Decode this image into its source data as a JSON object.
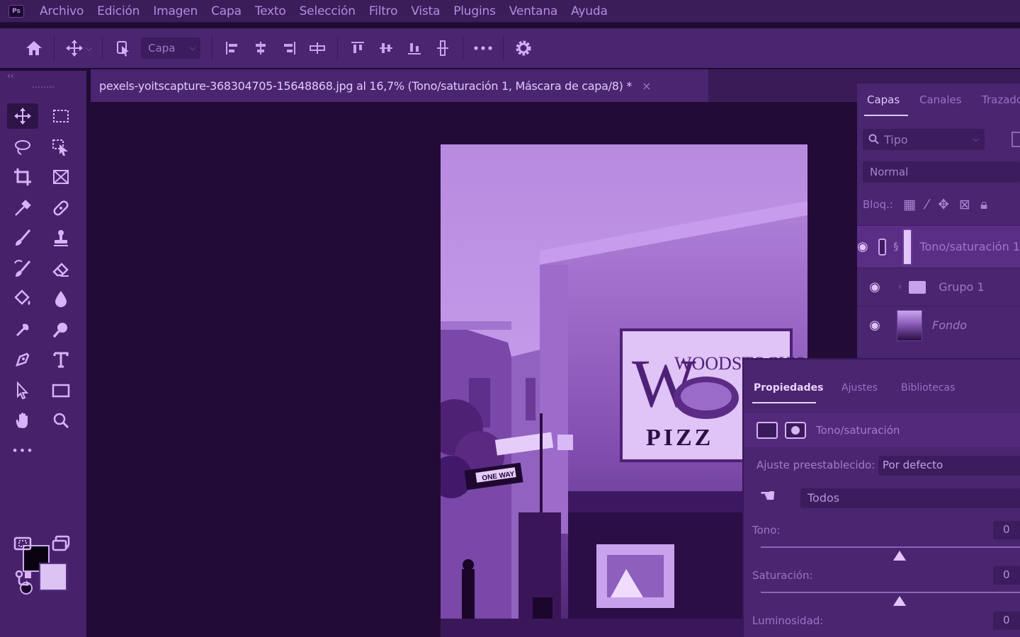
{
  "app": {
    "logo_text": "Ps"
  },
  "menu": [
    "Archivo",
    "Edición",
    "Imagen",
    "Capa",
    "Texto",
    "Selección",
    "Filtro",
    "Vista",
    "Plugins",
    "Ventana",
    "Ayuda"
  ],
  "options_bar": {
    "layer_select_value": "Capa",
    "icons": [
      "home-icon",
      "move-tool-icon",
      "auto-select-icon",
      "align-icons",
      "distribute-icons",
      "more-icon",
      "settings-icon"
    ]
  },
  "tools": {
    "collapse_glyph": "‹‹",
    "more_glyph": "•••"
  },
  "document": {
    "tab_title": "pexels-yoitscapture-368304705-15648868.jpg al 16,7% (Tono/saturación 1, Máscara de capa/8) *",
    "close_glyph": "×"
  },
  "photo": {
    "sign_text_top": "WOODSTOCK'S",
    "sign_text_bottom": "PIZZ",
    "street_sign": "ONE WAY"
  },
  "layers_panel": {
    "tabs": [
      "Capas",
      "Canales",
      "Trazados"
    ],
    "filter_label": "Tipo",
    "blend_mode": "Normal",
    "lock_label": "Bloq.:",
    "layers": [
      {
        "name": "Tono/saturación 1",
        "visible": true,
        "selected": true,
        "type": "adjustment"
      },
      {
        "name": "Grupo 1",
        "visible": true,
        "selected": false,
        "type": "group"
      },
      {
        "name": "Fondo",
        "visible": true,
        "selected": false,
        "type": "image"
      }
    ]
  },
  "properties_panel": {
    "tabs": [
      "Propiedades",
      "Ajustes",
      "Bibliotecas"
    ],
    "title": "Tono/saturación",
    "preset_label": "Ajuste preestablecido:",
    "preset_value": "Por defecto",
    "range_value": "Todos",
    "sliders": [
      {
        "label": "Tono:",
        "value": "0"
      },
      {
        "label": "Saturación:",
        "value": "0"
      },
      {
        "label": "Luminosidad:",
        "value": "0"
      }
    ]
  },
  "colors": {
    "foreground": "#0a0210",
    "background": "#dcc3f3",
    "accent": "#4a2570"
  }
}
